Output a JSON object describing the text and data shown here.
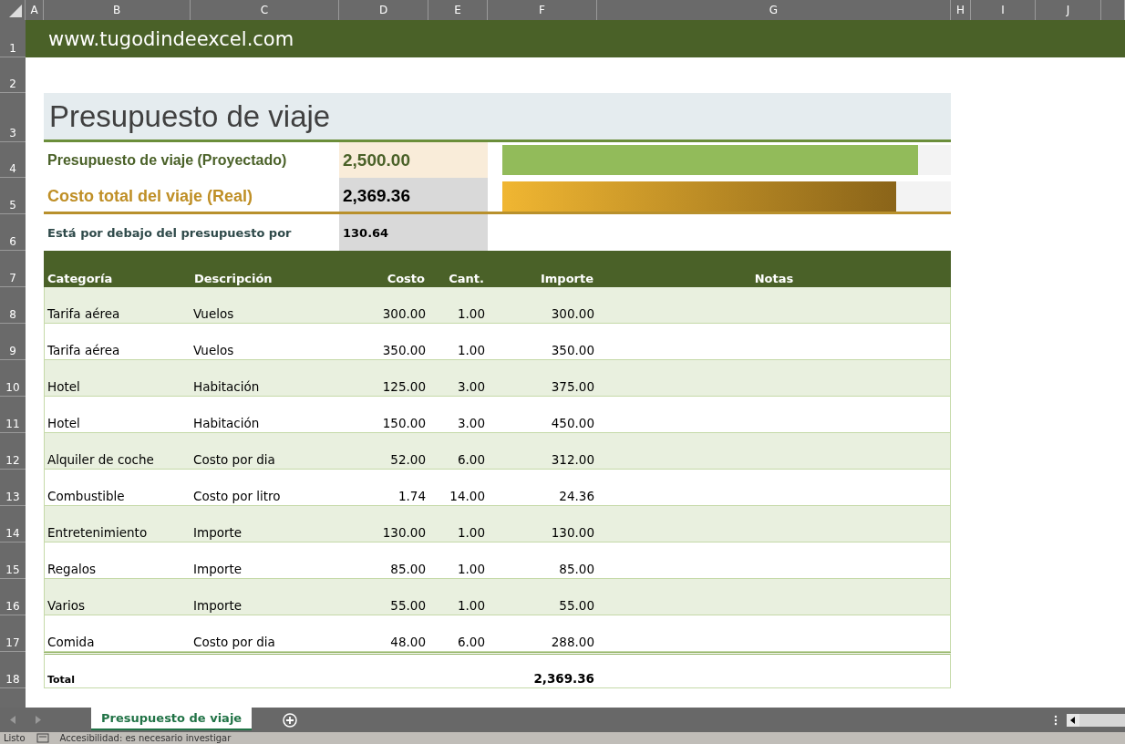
{
  "column_headers": [
    "A",
    "B",
    "C",
    "D",
    "E",
    "F",
    "G",
    "H",
    "I",
    "J"
  ],
  "row_numbers": [
    "1",
    "2",
    "3",
    "4",
    "5",
    "6",
    "7",
    "8",
    "9",
    "10",
    "11",
    "12",
    "13",
    "14",
    "15",
    "16",
    "17",
    "18"
  ],
  "site_banner": "www.tugodindeexcel.com",
  "title": "Presupuesto de viaje",
  "summary": [
    {
      "kind": "projected",
      "label": "Presupuesto de viaje (Proyectado)",
      "value": "2,500.00",
      "level": 0.927
    },
    {
      "kind": "actual",
      "label": "Costo total del viaje (Real)",
      "value": "2,369.36",
      "level": 0.878
    }
  ],
  "difference": {
    "label": "Está por debajo del presupuesto por",
    "value": "130.64"
  },
  "table": {
    "columns": [
      "Categoría",
      "Descripción",
      "Costo",
      "Cant.",
      "Importe",
      "Notas"
    ],
    "rows": [
      {
        "category": "Tarifa aérea",
        "description": "Vuelos",
        "cost": "300.00",
        "qty": "1.00",
        "amount": "300.00"
      },
      {
        "category": "Tarifa aérea",
        "description": "Vuelos",
        "cost": "350.00",
        "qty": "1.00",
        "amount": "350.00"
      },
      {
        "category": "Hotel",
        "description": "Habitación",
        "cost": "125.00",
        "qty": "3.00",
        "amount": "375.00"
      },
      {
        "category": "Hotel",
        "description": "Habitación",
        "cost": "150.00",
        "qty": "3.00",
        "amount": "450.00"
      },
      {
        "category": "Alquiler de coche",
        "description": "Costo por dia",
        "cost": "52.00",
        "qty": "6.00",
        "amount": "312.00"
      },
      {
        "category": "Combustible",
        "description": "Costo por litro",
        "cost": "1.74",
        "qty": "14.00",
        "amount": "24.36"
      },
      {
        "category": "Entretenimiento",
        "description": "Importe",
        "cost": "130.00",
        "qty": "1.00",
        "amount": "130.00"
      },
      {
        "category": "Regalos",
        "description": "Importe",
        "cost": "85.00",
        "qty": "1.00",
        "amount": "85.00"
      },
      {
        "category": "Varios",
        "description": "Importe",
        "cost": "55.00",
        "qty": "1.00",
        "amount": "55.00"
      },
      {
        "category": "Comida",
        "description": "Costo por dia",
        "cost": "48.00",
        "qty": "6.00",
        "amount": "288.00"
      }
    ],
    "total": {
      "label": "Total",
      "amount": "2,369.36"
    }
  },
  "sheet_tabs": [
    {
      "label": "Presupuesto de viaje",
      "selected": true
    }
  ],
  "status_bar": {
    "mode": "Listo",
    "accessibility": "Accesibilidad: es necesario investigar"
  }
}
